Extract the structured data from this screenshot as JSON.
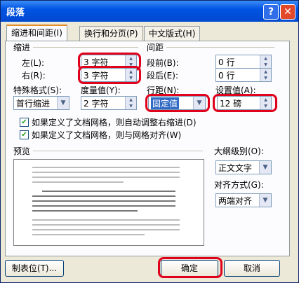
{
  "window": {
    "title": "段落",
    "help": "?",
    "close": "✕"
  },
  "tabs": [
    {
      "label": "缩进和间距(I)"
    },
    {
      "label": "换行和分页(P)"
    },
    {
      "label": "中文版式(H)"
    }
  ],
  "indent": {
    "section": "缩进",
    "left_label": "左(L):",
    "left_value": "3 字符",
    "right_label": "右(R):",
    "right_value": "3 字符",
    "special_label": "特殊格式(S):",
    "special_value": "首行缩进",
    "by_label": "度量值(Y):",
    "by_value": "2 字符"
  },
  "spacing": {
    "section": "间距",
    "before_label": "段前(B):",
    "before_value": "0 行",
    "after_label": "段后(E):",
    "after_value": "0 行",
    "line_label": "行距(N):",
    "line_value": "固定值",
    "at_label": "设置值(A):",
    "at_value": "12 磅"
  },
  "options": {
    "grid_indent": "如果定义了文档网格，则自动调整右缩进(D)",
    "grid_align": "如果定义了文档网格，则与网格对齐(W)",
    "grid_indent_checked": true,
    "grid_align_checked": true
  },
  "preview": {
    "label": "预览"
  },
  "outline": {
    "label": "大纲级别(O):",
    "value": "正文文字"
  },
  "alignment": {
    "label": "对齐方式(G):",
    "value": "两端对齐"
  },
  "buttons": {
    "tabs": "制表位(T)...",
    "ok": "确定",
    "cancel": "取消"
  },
  "icons": {
    "spin": "spin-arrows",
    "dropdown": "dropdown-arrow",
    "check": "checkmark"
  },
  "colors": {
    "highlight": "#e0001b",
    "selection": "#316ac5",
    "titlebar": "#0054e3"
  }
}
